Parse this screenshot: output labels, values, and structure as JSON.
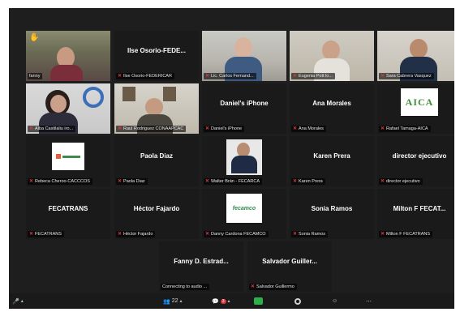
{
  "tiles": [
    {
      "tag": "fanny",
      "center": "",
      "muted": false,
      "hand": true
    },
    {
      "tag": "Ilse Osorio-FEDERICAR",
      "center": "Ilse  Osorio-FEDE...",
      "muted": true
    },
    {
      "tag": "Lic. Carlos Fernand...",
      "center": "",
      "muted": true
    },
    {
      "tag": "Eugenia Pott lo...",
      "center": "",
      "muted": true
    },
    {
      "tag": "Sara Cabrera Vasquez",
      "center": "",
      "muted": true
    },
    {
      "tag": "Alba Castilaliu iro...",
      "center": "",
      "muted": true
    },
    {
      "tag": "Raul Rodriguez CONAAPCAC",
      "center": "",
      "muted": true
    },
    {
      "tag": "Daniel's iPhone",
      "center": "Daniel's iPhone",
      "muted": true
    },
    {
      "tag": "Ana Morales",
      "center": "Ana Morales",
      "muted": true
    },
    {
      "tag": "Rafael Tamaga-AICA",
      "center": "",
      "muted": true
    },
    {
      "tag": "Rebeca Cheroo-CACCCOS",
      "center": "",
      "muted": true
    },
    {
      "tag": "Paola Diaz",
      "center": "Paola Diaz",
      "muted": true
    },
    {
      "tag": "Walter Brán - FECARCA",
      "center": "",
      "muted": true
    },
    {
      "tag": "Karen Prera",
      "center": "Karen Prera",
      "muted": true
    },
    {
      "tag": "director ejecutivo",
      "center": "director ejecutivo",
      "muted": true
    },
    {
      "tag": "FECATRANS",
      "center": "FECATRANS",
      "muted": true
    },
    {
      "tag": "Héctor Fajardo",
      "center": "Héctor Fajardo",
      "muted": true
    },
    {
      "tag": "Danny Cardona FECAMCO",
      "center": "",
      "muted": true
    },
    {
      "tag": "Sonia Ramos",
      "center": "Sonia Ramos",
      "muted": true
    },
    {
      "tag": "Milton F FECATRANS",
      "center": "Milton F FECAT...",
      "muted": true
    },
    {
      "tag": "Connecting to audio ...",
      "center": "Fanny D. Estrad...",
      "muted": false
    },
    {
      "tag": "Salvador Guillermo",
      "center": "Salvador  Guiller...",
      "muted": true
    }
  ],
  "logos": {
    "aica": "AICA",
    "fecamco": "fecamco"
  },
  "toolbar": {
    "participants_count": "22",
    "chat_badge": "3"
  },
  "colors": {
    "speaking_border": "#c8e05a",
    "muted_mic": "#e0393e",
    "tile_bg": "#1a1a1a"
  }
}
